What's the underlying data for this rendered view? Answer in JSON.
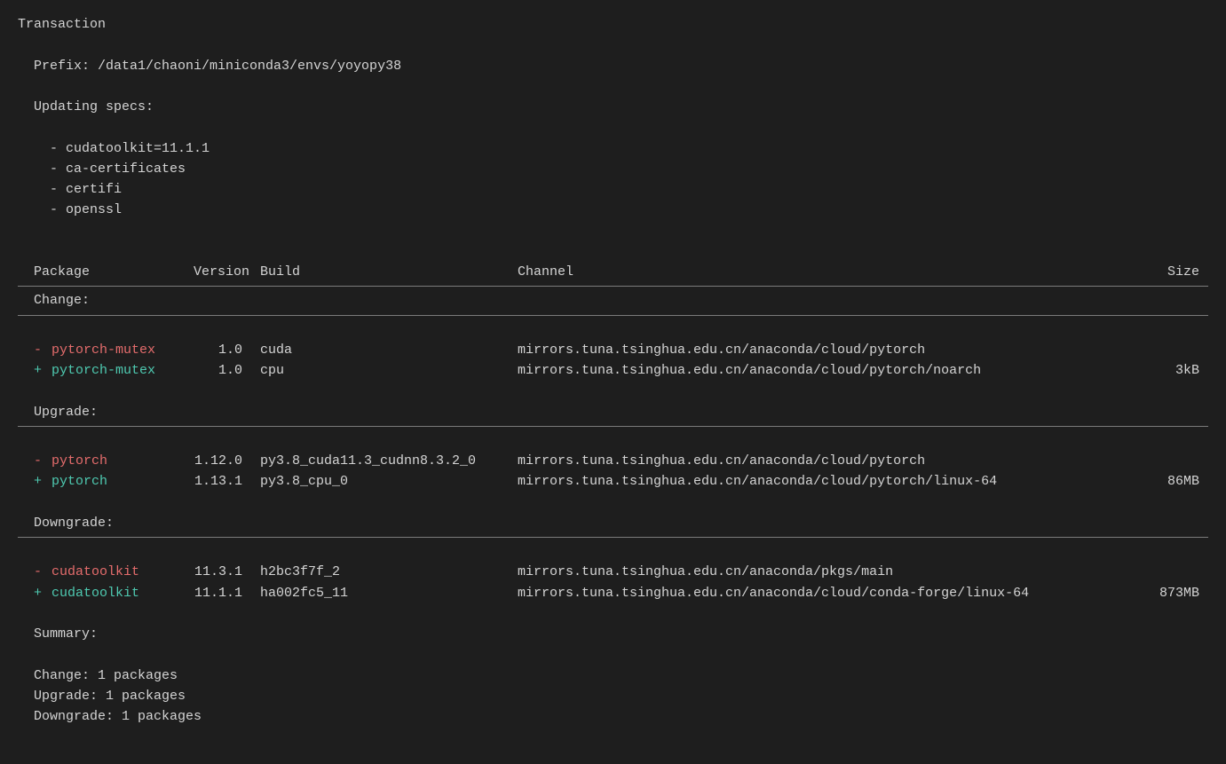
{
  "transaction_label": "Transaction",
  "prefix_line": "Prefix: /data1/chaoni/miniconda3/envs/yoyopy38",
  "updating_specs_label": "Updating specs:",
  "specs": [
    "cudatoolkit=11.1.1",
    "ca-certificates",
    "certifi",
    "openssl"
  ],
  "headers": {
    "package": "Package",
    "version": "Version",
    "build": "Build",
    "channel": "Channel",
    "size": "Size"
  },
  "sections": {
    "change": {
      "label": "Change:",
      "rows": [
        {
          "sign": "-",
          "pkg": "pytorch-mutex",
          "version": "1.0",
          "build": "cuda",
          "channel": "mirrors.tuna.tsinghua.edu.cn/anaconda/cloud/pytorch",
          "size": "",
          "cls": "remove"
        },
        {
          "sign": "+",
          "pkg": "pytorch-mutex",
          "version": "1.0",
          "build": "cpu",
          "channel": "mirrors.tuna.tsinghua.edu.cn/anaconda/cloud/pytorch/noarch",
          "size": "3kB",
          "cls": "add"
        }
      ]
    },
    "upgrade": {
      "label": "Upgrade:",
      "rows": [
        {
          "sign": "-",
          "pkg": "pytorch",
          "version": "1.12.0",
          "build": "py3.8_cuda11.3_cudnn8.3.2_0",
          "channel": "mirrors.tuna.tsinghua.edu.cn/anaconda/cloud/pytorch",
          "size": "",
          "cls": "remove"
        },
        {
          "sign": "+",
          "pkg": "pytorch",
          "version": "1.13.1",
          "build": "py3.8_cpu_0",
          "channel": "mirrors.tuna.tsinghua.edu.cn/anaconda/cloud/pytorch/linux-64",
          "size": "86MB",
          "cls": "add"
        }
      ]
    },
    "downgrade": {
      "label": "Downgrade:",
      "rows": [
        {
          "sign": "-",
          "pkg": "cudatoolkit",
          "version": "11.3.1",
          "build": "h2bc3f7f_2",
          "channel": "mirrors.tuna.tsinghua.edu.cn/anaconda/pkgs/main",
          "size": "",
          "cls": "remove"
        },
        {
          "sign": "+",
          "pkg": "cudatoolkit",
          "version": "11.1.1",
          "build": "ha002fc5_11",
          "channel": "mirrors.tuna.tsinghua.edu.cn/anaconda/cloud/conda-forge/linux-64",
          "size": "873MB",
          "cls": "add"
        }
      ]
    }
  },
  "summary": {
    "label": "Summary:",
    "lines": [
      "Change: 1 packages",
      "Upgrade: 1 packages",
      "Downgrade: 1 packages"
    ]
  }
}
